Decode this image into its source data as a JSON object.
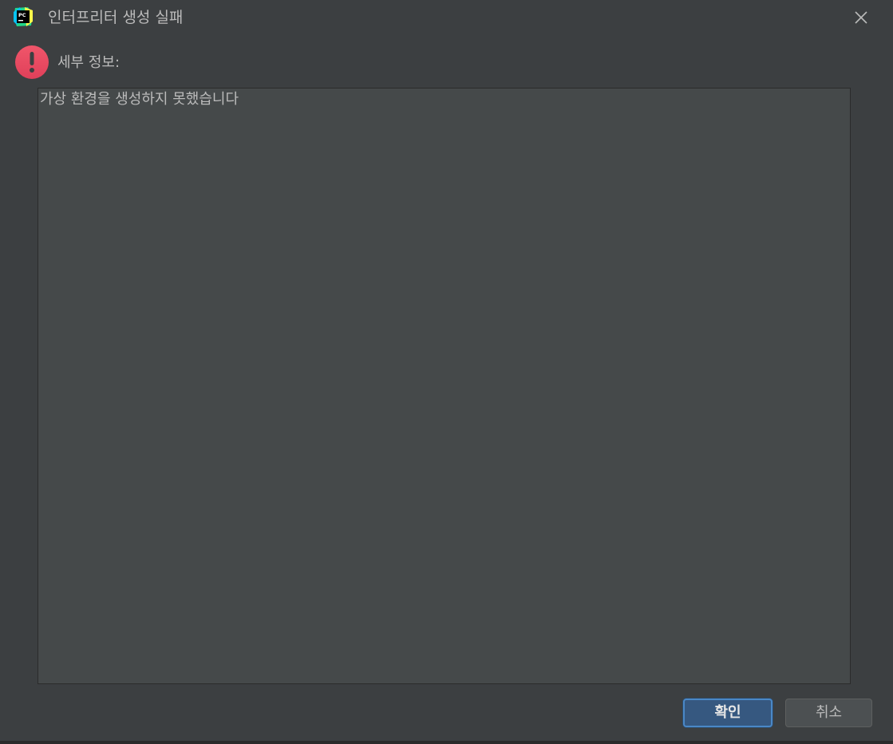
{
  "window": {
    "title": "인터프리터 생성 실패",
    "app_icon": "pycharm-logo-icon",
    "app_icon_text": "PC",
    "close_icon": "close-icon"
  },
  "message": {
    "icon": "error-icon",
    "icon_color": "#e8455f",
    "label": "세부 정보:",
    "details_text": "가상 환경을 생성하지 못했습니다"
  },
  "buttons": {
    "ok_label": "확인",
    "cancel_label": "취소"
  },
  "colors": {
    "background": "#3c3f41",
    "text_area": "#45494a",
    "primary_button": "#365880",
    "primary_button_border": "#4a88c7",
    "secondary_button": "#4c5052",
    "text": "#bbbbbb"
  }
}
